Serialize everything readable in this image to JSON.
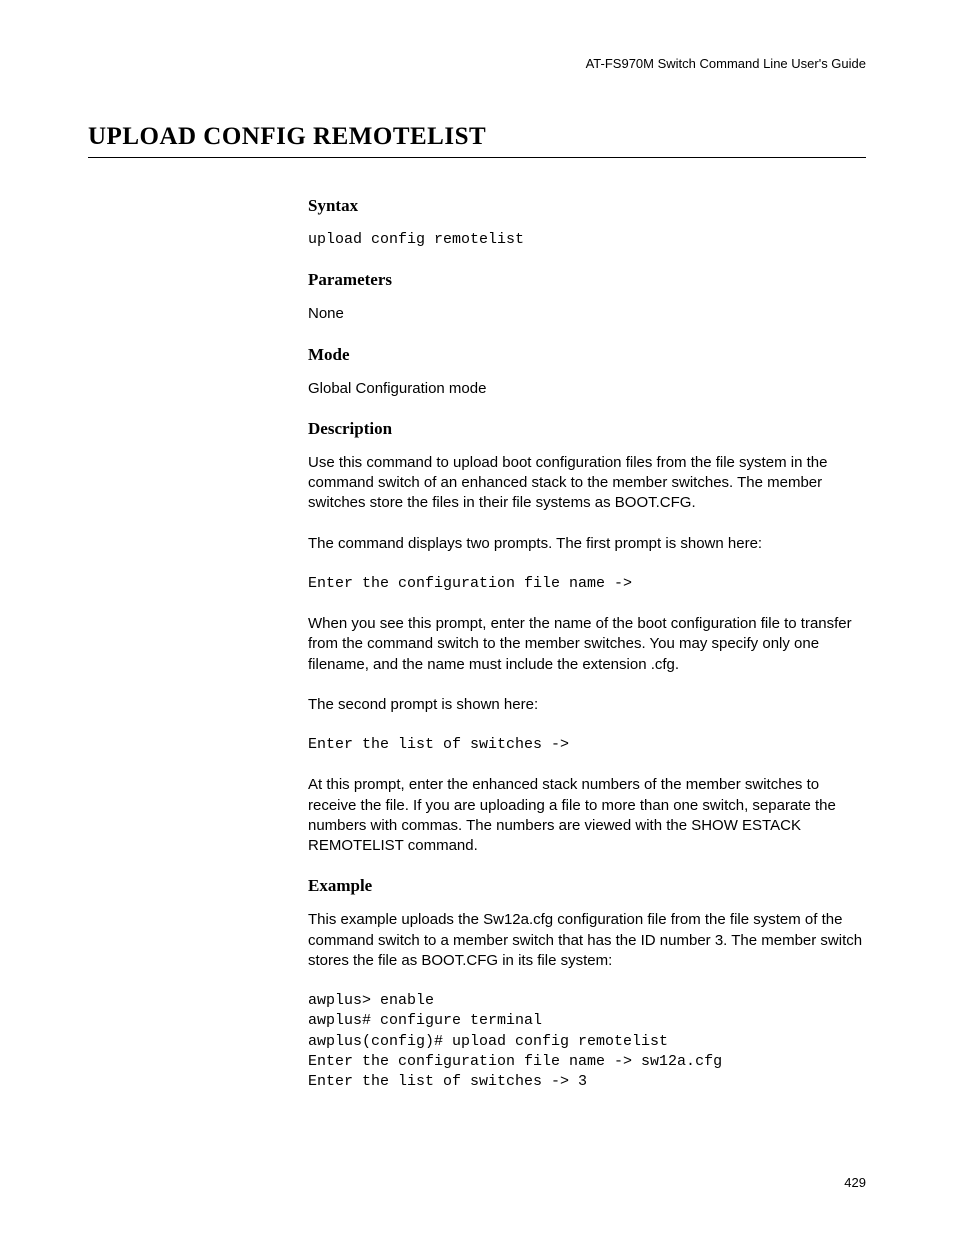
{
  "header": {
    "guide_title": "AT-FS970M Switch Command Line User's Guide"
  },
  "title": "UPLOAD CONFIG REMOTELIST",
  "sections": {
    "syntax": {
      "heading": "Syntax",
      "code": "upload config remotelist"
    },
    "parameters": {
      "heading": "Parameters",
      "text": "None"
    },
    "mode": {
      "heading": "Mode",
      "text": "Global Configuration mode"
    },
    "description": {
      "heading": "Description",
      "para1": "Use this command to upload boot configuration files from the file system in the command switch of an enhanced stack to the member switches. The member switches store the files in their file systems as BOOT.CFG.",
      "para2": "The command displays two prompts. The first prompt is shown here:",
      "code1": "Enter the configuration file name ->",
      "para3": "When you see this prompt, enter the name of the boot configuration file to transfer from the command switch to the member switches. You may specify only one filename, and the name must include the extension .cfg.",
      "para4": "The second prompt is shown here:",
      "code2": "Enter the list of switches ->",
      "para5": "At this prompt, enter the enhanced stack numbers of the member switches to receive the file. If you are uploading a file to more than one switch, separate the numbers with commas. The numbers are viewed with the SHOW ESTACK REMOTELIST command."
    },
    "example": {
      "heading": "Example",
      "para1": "This example uploads the Sw12a.cfg configuration file from the file system of the command switch to a member switch that has the ID number 3. The member switch stores the file as BOOT.CFG in its file system:",
      "code": "awplus> enable\nawplus# configure terminal\nawplus(config)# upload config remotelist\nEnter the configuration file name -> sw12a.cfg\nEnter the list of switches -> 3"
    }
  },
  "page_number": "429"
}
